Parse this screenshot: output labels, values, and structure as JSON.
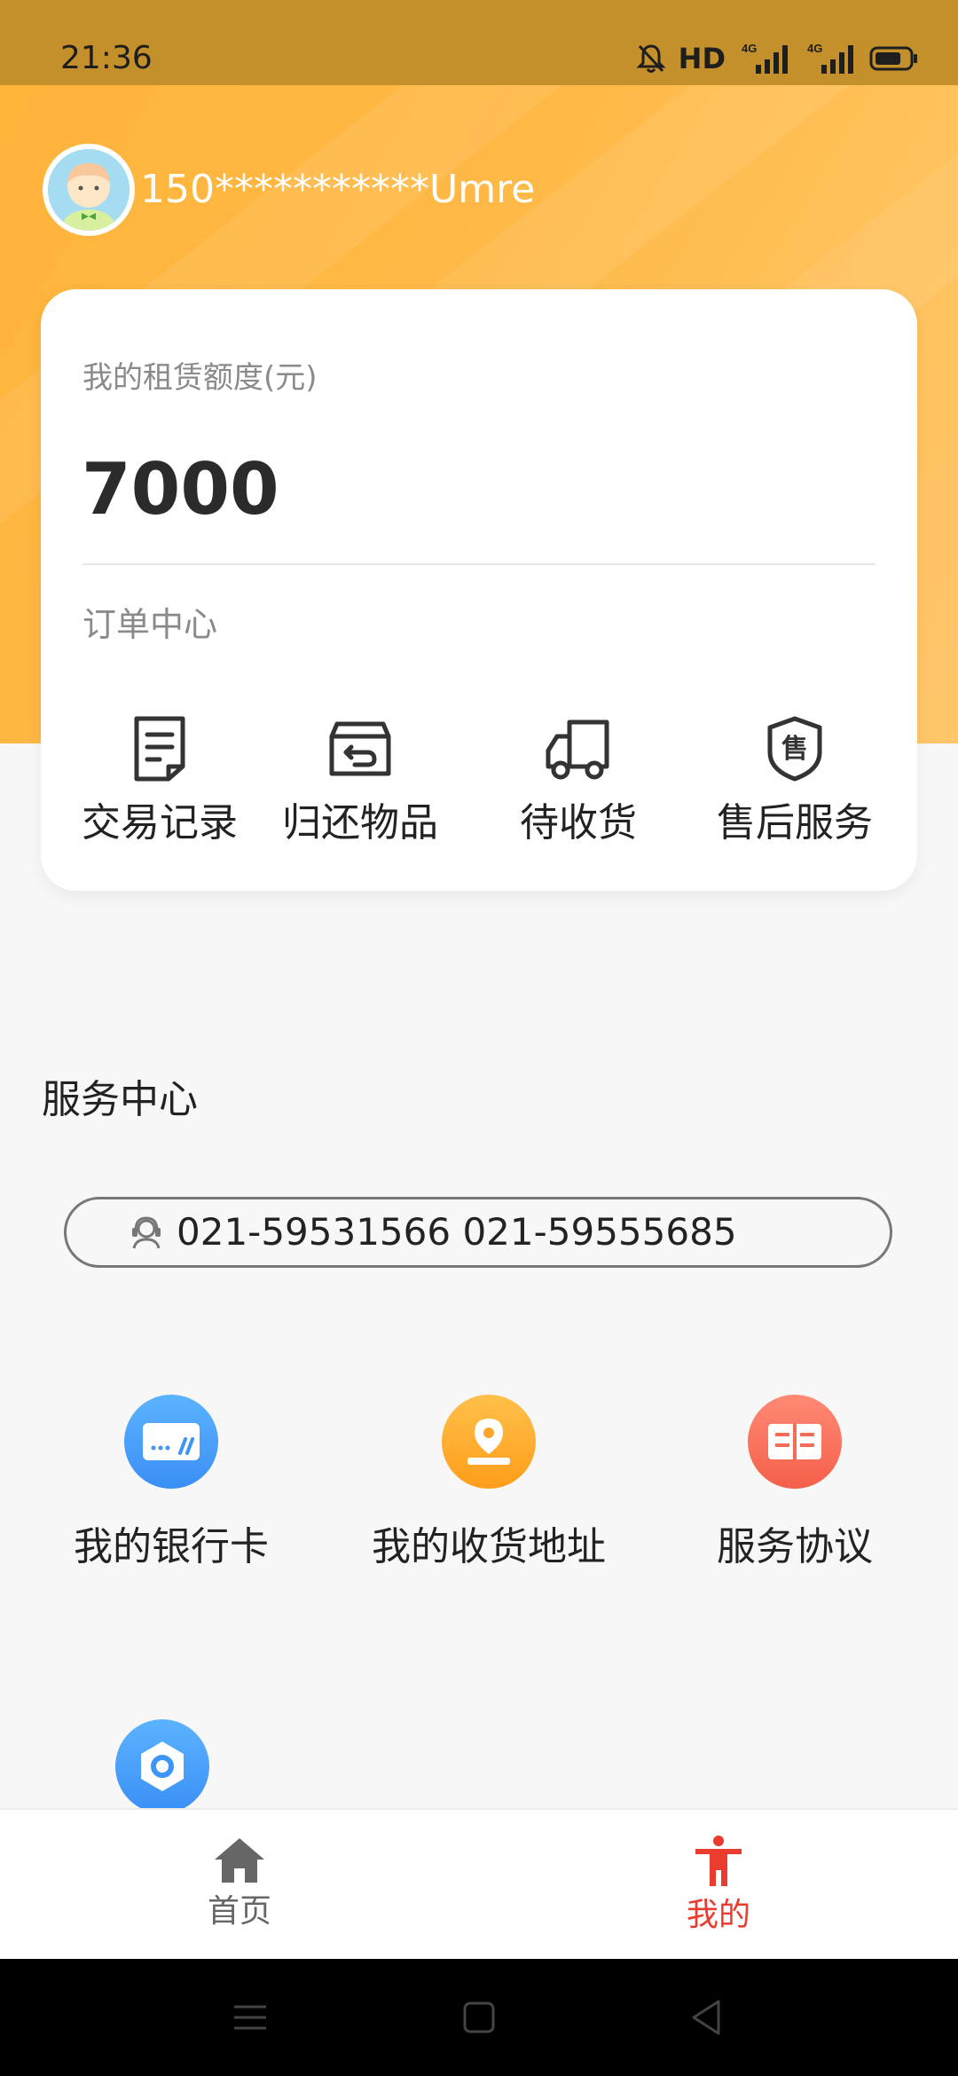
{
  "status_bar": {
    "time": "21:36",
    "hd_label": "HD",
    "network_1": "4G",
    "network_2": "4G",
    "icons": [
      "mute-bell-icon",
      "hd-icon",
      "signal-icon",
      "signal-icon",
      "battery-icon"
    ]
  },
  "profile": {
    "name": "150***********Umre"
  },
  "quota": {
    "label": "我的租赁额度(元)",
    "value": "7000"
  },
  "orders": {
    "title": "订单中心",
    "items": [
      {
        "label": "交易记录",
        "icon": "document-icon"
      },
      {
        "label": "归还物品",
        "icon": "return-box-icon"
      },
      {
        "label": "待收货",
        "icon": "truck-icon"
      },
      {
        "label": "售后服务",
        "icon": "shield-icon",
        "icon_text": "售"
      }
    ]
  },
  "service": {
    "title": "服务中心",
    "phone": "021-59531566 021-59555685",
    "items": [
      {
        "label": "我的银行卡",
        "icon": "bank-card-icon",
        "color": "#3d95f5"
      },
      {
        "label": "我的收货地址",
        "icon": "location-icon",
        "color": "#ffaa22"
      },
      {
        "label": "服务协议",
        "icon": "book-icon",
        "color": "#f86b55"
      }
    ],
    "extra_icon": "settings-icon"
  },
  "nav": {
    "home": "首页",
    "mine": "我的",
    "active_color": "#e93c2f",
    "inactive_color": "#666666"
  },
  "colors": {
    "header": "#ffb947",
    "status_bar": "#c4902c"
  }
}
